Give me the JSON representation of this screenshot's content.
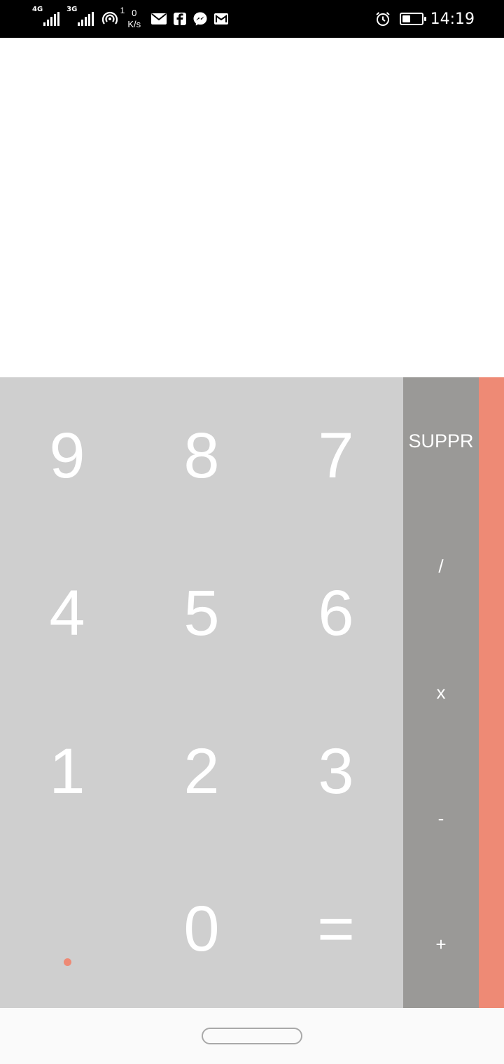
{
  "status_bar": {
    "network_1": "4G",
    "network_2": "3G",
    "hotspot_count": "1",
    "speed_value": "0",
    "speed_unit": "K/s",
    "notification_icons": [
      "mail-icon",
      "facebook-icon",
      "messenger-icon",
      "gmail-icon"
    ],
    "battery_level": 0.45,
    "time": "14:19"
  },
  "display": {
    "value": ""
  },
  "keypad": {
    "rows": [
      [
        "9",
        "8",
        "7"
      ],
      [
        "4",
        "5",
        "6"
      ],
      [
        "1",
        "2",
        "3"
      ],
      [
        ".",
        "0",
        "="
      ]
    ]
  },
  "operators": {
    "delete_label": "SUPPR",
    "divide_label": "/",
    "multiply_label": "x",
    "subtract_label": "-",
    "add_label": "+"
  },
  "colors": {
    "display_bg": "#ffffff",
    "keypad_bg": "#cfcfcf",
    "operators_bg": "#9a9997",
    "accent": "#ee8a75",
    "key_text": "#ffffff"
  }
}
